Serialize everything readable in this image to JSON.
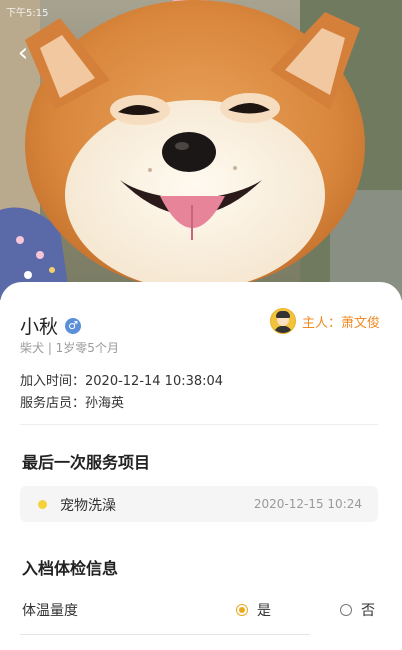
{
  "status_bar": {
    "time": "下午5:15"
  },
  "hero": {
    "image": "shiba-dog-photo"
  },
  "pet": {
    "name": "小秋",
    "gender_icon": "male-icon",
    "breed_age": "柴犬 | 1岁零5个月",
    "owner": "主人：萧文俊",
    "join_time": "加入时间：2020-12-14 10:38:04",
    "staff": "服务店员：孙海英"
  },
  "last_service": {
    "title": "最后一次服务项目",
    "name": "宠物洗澡",
    "time": "2020-12-15 10:24"
  },
  "checkup": {
    "title": "入档体检信息",
    "temp_label": "体温量度",
    "options": [
      "是",
      "否"
    ],
    "selected": "是"
  },
  "colors": {
    "accent": "#f08a24",
    "radio": "#e8a91f",
    "dot": "#f6d23a",
    "gender": "#5b8fd8"
  }
}
